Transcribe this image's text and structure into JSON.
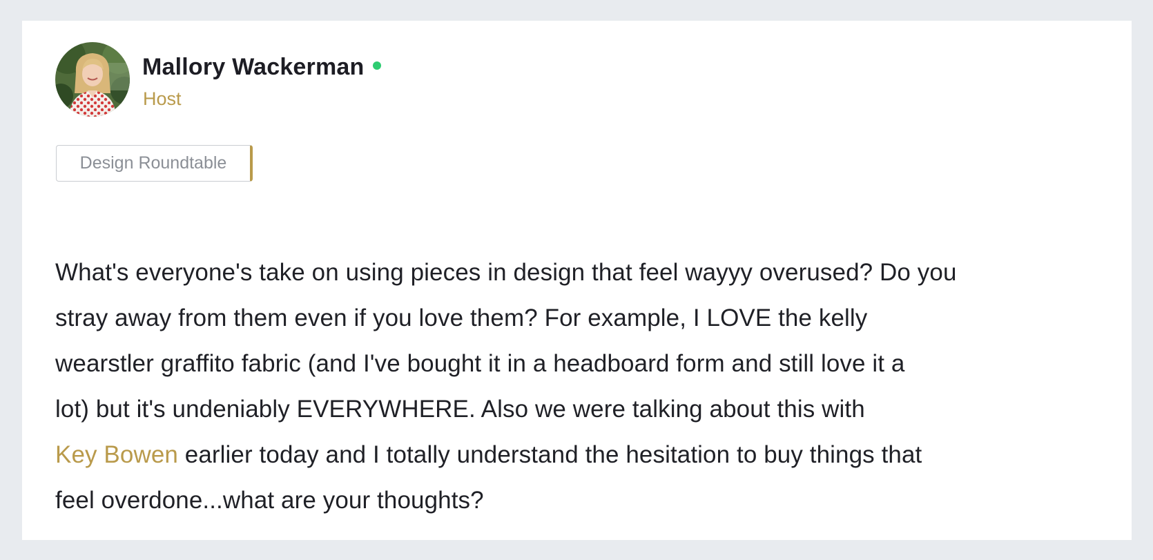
{
  "post": {
    "author": {
      "name": "Mallory Wackerman",
      "role": "Host",
      "online": true
    },
    "tag": "Design Roundtable",
    "body_lines": [
      "What's everyone's take on using pieces in design that feel wayyy overused? Do you",
      "stray away from them even if you love them? For example, I LOVE the kelly",
      "wearstler graffito fabric (and I've bought it in a headboard form and still love it a",
      "lot) but it's undeniably EVERYWHERE. Also we were talking about this with"
    ],
    "mention": "Key Bowen",
    "after_mention": " earlier today and I totally understand the hesitation to buy things that",
    "last_line": "feel overdone...what are your thoughts?"
  },
  "colors": {
    "accent_gold": "#b99a4b",
    "online_green": "#2ecc71",
    "text_dark": "#1f2026",
    "page_bg": "#e8ebef"
  },
  "icons": {
    "online_indicator": "online-status-dot"
  }
}
